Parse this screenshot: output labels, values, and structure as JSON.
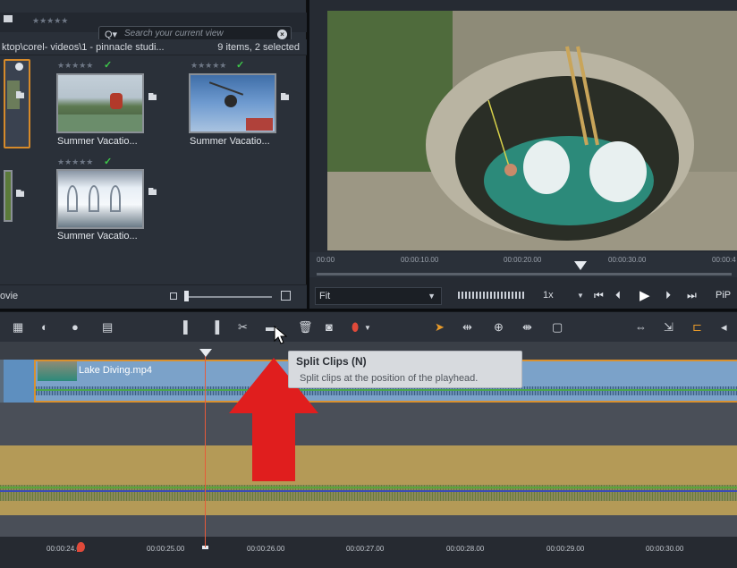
{
  "library": {
    "search_placeholder": "Search your current view",
    "search_dropdown": "Q▾",
    "path": "ktop\\corel- videos\\1 - pinnacle studi...",
    "count": "9 items, 2 selected",
    "header_stars": "★★★★★",
    "view_label": "ovie",
    "items": [
      {
        "caption": "Summer Vacatio...",
        "stars": "★★★★★",
        "checked": true
      },
      {
        "caption": "Summer Vacatio...",
        "stars": "★★★★★",
        "checked": true
      },
      {
        "caption": "Summer Vacatio...",
        "stars": "★★★★★",
        "checked": true
      }
    ]
  },
  "player": {
    "ruler": [
      "00:00",
      "00:00:10.00",
      "00:00:20.00",
      "00:00:30.00",
      "00:00:4"
    ],
    "fit_label": "Fit",
    "speed_label": "1x",
    "pip_label": "PiP"
  },
  "timeline": {
    "clip_name": "Lake Diving.mp4",
    "timecodes": [
      "00:00:24.00",
      "00:00:25.00",
      "00:00:26.00",
      "00:00:27.00",
      "00:00:28.00",
      "00:00:29.00",
      "00:00:30.00"
    ],
    "tooltip_title": "Split Clips (N)",
    "tooltip_desc": "Split clips at the position of the playhead."
  },
  "colors": {
    "accent": "#d9912f",
    "check": "#3ec94a",
    "video_track": "#7ba2c9",
    "audio_track": "#b49a57",
    "arrow": "#e01e1e",
    "playhead": "#e55a3a"
  },
  "icons": [
    "menu-icon",
    "search-icon",
    "clear-icon",
    "folder-icon",
    "storyboard-icon",
    "effects-icon",
    "titles-icon",
    "sound-icon",
    "marker-icon",
    "split-icon",
    "delete-icon",
    "snapshot-icon",
    "pointer-icon",
    "trim-icon",
    "play-icon",
    "prev-frame-icon",
    "next-frame-icon"
  ]
}
